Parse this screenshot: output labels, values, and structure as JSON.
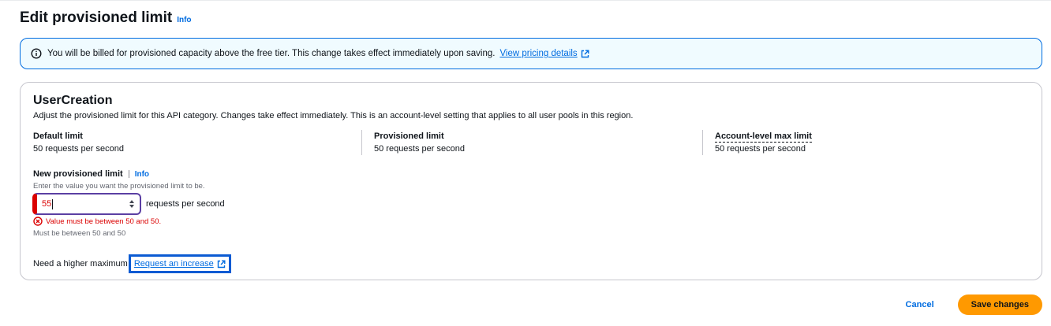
{
  "header": {
    "title": "Edit provisioned limit",
    "info_label": "Info"
  },
  "alert": {
    "icon": "info-circle-icon",
    "text": "You will be billed for provisioned capacity above the free tier. This change takes effect immediately upon saving.",
    "link_label": "View pricing details",
    "link_icon": "external-link-icon"
  },
  "card": {
    "title": "UserCreation",
    "description": "Adjust the provisioned limit for this API category. Changes take effect immediately. This is an account-level setting that applies to all user pools in this region.",
    "limits": [
      {
        "label": "Default limit",
        "value": "50 requests per second"
      },
      {
        "label": "Provisioned limit",
        "value": "50 requests per second"
      },
      {
        "label": "Account-level max limit",
        "value": "50 requests per second"
      }
    ]
  },
  "field": {
    "label": "New provisioned limit",
    "info_label": "Info",
    "description": "Enter the value you want the provisioned limit to be.",
    "value": "55",
    "unit": "requests per second",
    "error": "Value must be between 50 and 50.",
    "constraint": "Must be between 50 and 50"
  },
  "higher": {
    "text": "Need a higher maximum",
    "link_label": "Request an increase"
  },
  "footer": {
    "cancel_label": "Cancel",
    "save_label": "Save changes"
  },
  "colors": {
    "accent": "#006ce0",
    "error": "#db0000",
    "primary_button": "#ff9900",
    "alert_bg": "#f0fbff",
    "focus_outline": "#0b5bd3"
  }
}
